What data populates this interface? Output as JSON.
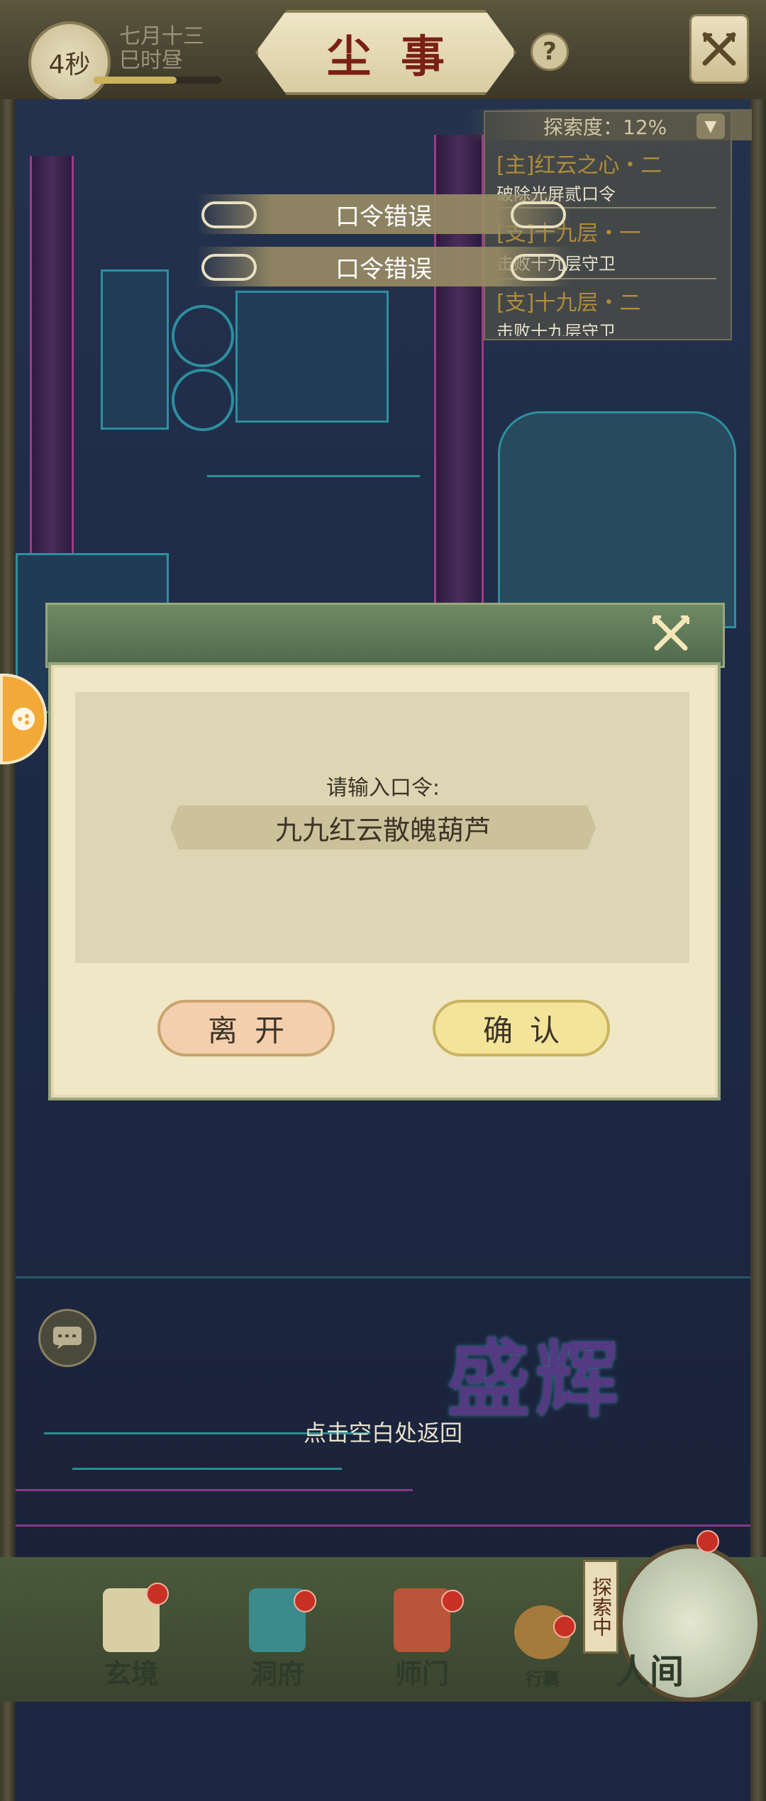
{
  "header": {
    "timer": "4秒",
    "date_line1": "七月十三",
    "date_line2": "巳时昼",
    "title": "尘事",
    "help_icon": "?"
  },
  "explore": {
    "progress_label": "探索度：12%",
    "progress_percent": 12,
    "quests": [
      {
        "title": "[主]红云之心・二",
        "desc": "破除光屏贰口令"
      },
      {
        "title": "[支]十九层・一",
        "desc": "击败十九层守卫"
      },
      {
        "title": "[支]十九层・二",
        "desc": "击败十九层守卫"
      }
    ]
  },
  "toasts": [
    "口令错误",
    "口令错误"
  ],
  "dialog": {
    "prompt": "请输入口令:",
    "password": "九九红云散魄葫芦",
    "leave_label": "离开",
    "confirm_label": "确认"
  },
  "banner": "盛辉",
  "return_hint": "点击空白处返回",
  "nav": {
    "items": [
      "玄境",
      "洞府",
      "师门",
      "行囊"
    ],
    "explore_tag": "探索中",
    "main_label": "人间"
  },
  "colors": {
    "title_red": "#7a2014",
    "leave_button": "#f4cfae",
    "confirm_button": "#f3e49a",
    "dialog_header": "#5b7756",
    "quest_gold": "#b08c3a"
  }
}
